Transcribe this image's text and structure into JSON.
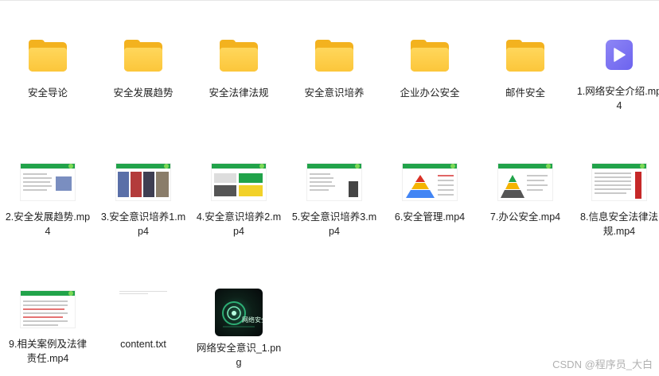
{
  "row1": [
    {
      "type": "folder",
      "label": "安全导论"
    },
    {
      "type": "folder",
      "label": "安全发展趋势"
    },
    {
      "type": "folder",
      "label": "安全法律法规"
    },
    {
      "type": "folder",
      "label": "安全意识培养"
    },
    {
      "type": "folder",
      "label": "企业办公安全"
    },
    {
      "type": "folder",
      "label": "邮件安全"
    },
    {
      "type": "video",
      "label": "1.网络安全介绍.mp4"
    }
  ],
  "row2": [
    {
      "label": "2.安全发展趋势.mp4"
    },
    {
      "label": "3.安全意识培养1.mp4"
    },
    {
      "label": "4.安全意识培养2.mp4"
    },
    {
      "label": "5.安全意识培养3.mp4"
    },
    {
      "label": "6.安全管理.mp4"
    },
    {
      "label": "7.办公安全.mp4"
    },
    {
      "label": "8.信息安全法律法规.mp4"
    }
  ],
  "row3": [
    {
      "label": "9.相关案例及法律责任.mp4"
    },
    {
      "label": "content.txt"
    },
    {
      "label": "网络安全意识_1.png",
      "image_text": "网络安全"
    }
  ],
  "watermark": "CSDN @程序员_大白",
  "colors": {
    "folder": "#fcc63a",
    "video_icon": "#7b73f2",
    "slide_bar": "#21a34a"
  }
}
